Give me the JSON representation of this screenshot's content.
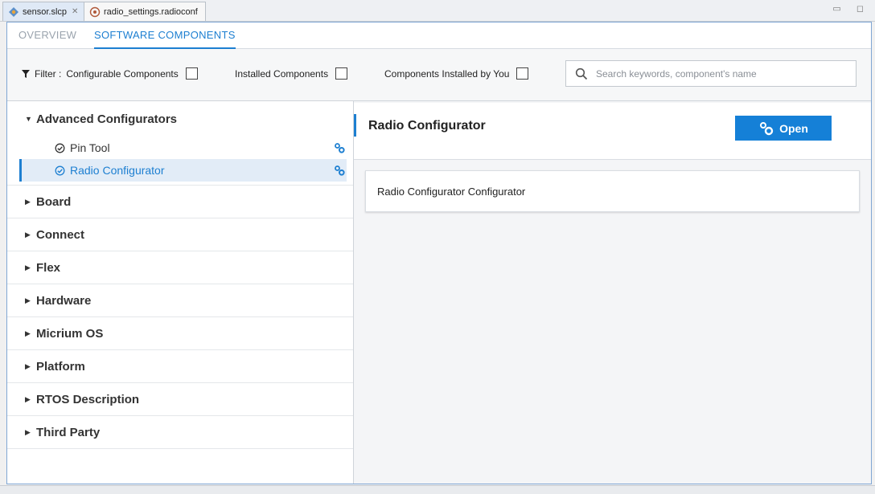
{
  "editor_tabs": [
    {
      "label": "sensor.slcp",
      "icon": "project-icon",
      "close": "✕"
    },
    {
      "label": "radio_settings.radioconf",
      "icon": "radio-icon"
    }
  ],
  "nav": {
    "overview": "OVERVIEW",
    "software_components": "SOFTWARE COMPONENTS"
  },
  "filter": {
    "label": "Filter :",
    "configurable": "Configurable Components",
    "installed": "Installed Components",
    "installed_by_you": "Components Installed by You"
  },
  "search": {
    "placeholder": "Search keywords, component's name"
  },
  "tree": {
    "open_group": {
      "label": "Advanced Configurators",
      "children": [
        {
          "label": "Pin Tool",
          "selected": false
        },
        {
          "label": "Radio Configurator",
          "selected": true
        }
      ]
    },
    "groups": [
      "Board",
      "Connect",
      "Flex",
      "Hardware",
      "Micrium OS",
      "Platform",
      "RTOS Description",
      "Third Party"
    ]
  },
  "detail": {
    "title": "Radio Configurator",
    "open_label": "Open",
    "card_text": "Radio Configurator Configurator"
  },
  "colors": {
    "accent": "#1d7fd1",
    "button": "#1580d7",
    "selected_bg": "#e2ecf7"
  }
}
